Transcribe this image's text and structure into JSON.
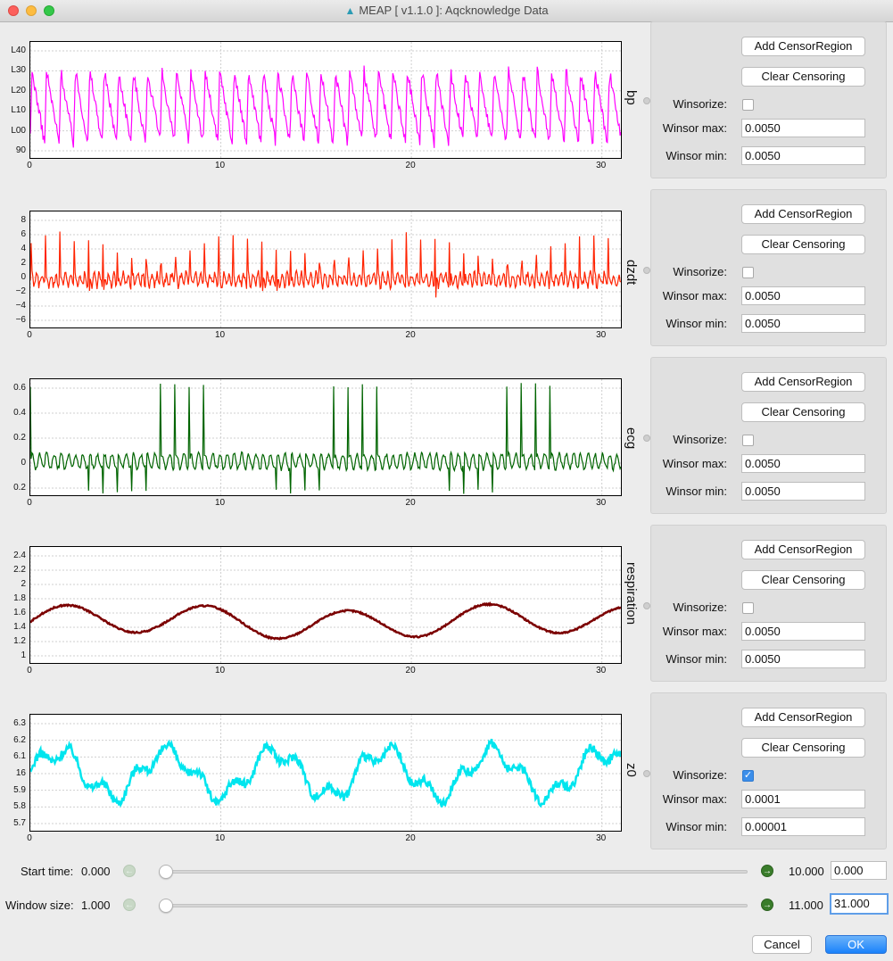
{
  "window": {
    "title": "MEAP [ v1.1.0 ]: Aqcknowledge Data",
    "icon": "meap-app-icon"
  },
  "xaxis": {
    "ticks": [
      "0",
      "10",
      "20",
      "30"
    ],
    "range": [
      0,
      31
    ]
  },
  "channels": [
    {
      "label": "bp",
      "color": "#ff00ff",
      "yticks": [
        "140",
        "130",
        "120",
        "110",
        "100",
        "90"
      ],
      "yticks_display": [
        "L40",
        "L30",
        "L20",
        "L10",
        "L00",
        "90"
      ],
      "ylim": [
        85,
        145
      ],
      "winsorize": false,
      "winsor_max": "0.0050",
      "winsor_min": "0.0050"
    },
    {
      "label": "dzdt",
      "color": "#ff2200",
      "yticks_display": [
        "8",
        "6",
        "4",
        "2",
        "0",
        "−2",
        "−4",
        "−6"
      ],
      "ylim": [
        -6.2,
        8.8
      ],
      "winsorize": false,
      "winsor_max": "0.0050",
      "winsor_min": "0.0050"
    },
    {
      "label": "ecg",
      "color": "#006400",
      "yticks_display": [
        "0.6",
        "0.4",
        "0.2",
        "0",
        "0.2"
      ],
      "ylim": [
        -0.23,
        0.73
      ],
      "winsorize": false,
      "winsor_max": "0.0050",
      "winsor_min": "0.0050"
    },
    {
      "label": "respiration",
      "color": "#7b0000",
      "yticks_display": [
        "2.4",
        "2.2",
        "2",
        "1.8",
        "1.6",
        "1.4",
        "1.2",
        "1"
      ],
      "ylim": [
        0.88,
        2.48
      ],
      "winsorize": false,
      "winsor_max": "0.0050",
      "winsor_min": "0.0050"
    },
    {
      "label": "z0",
      "color": "#00e5ee",
      "yticks_display": [
        "6.3",
        "6.2",
        "6.1",
        "16",
        "5.9",
        "5.8",
        "5.7"
      ],
      "ylim": [
        5.68,
        6.33
      ],
      "winsorize": true,
      "winsor_max": "0.0001",
      "winsor_min": "0.00001"
    }
  ],
  "panel_labels": {
    "add_censor": "Add CensorRegion",
    "clear_censor": "Clear Censoring",
    "winsorize": "Winsorize:",
    "winsor_max": "Winsor max:",
    "winsor_min": "Winsor min:"
  },
  "start_time": {
    "label": "Start time:",
    "value": "0.000",
    "max": "10.000",
    "field": "0.000",
    "fraction": 0.0
  },
  "window_size": {
    "label": "Window size:",
    "value": "1.000",
    "max": "11.000",
    "field": "31.000",
    "fraction": 0.0
  },
  "buttons": {
    "cancel": "Cancel",
    "ok": "OK"
  },
  "colors": {
    "ok_blue": "#1a82fb",
    "arrow_green": "#3a7d2b"
  }
}
